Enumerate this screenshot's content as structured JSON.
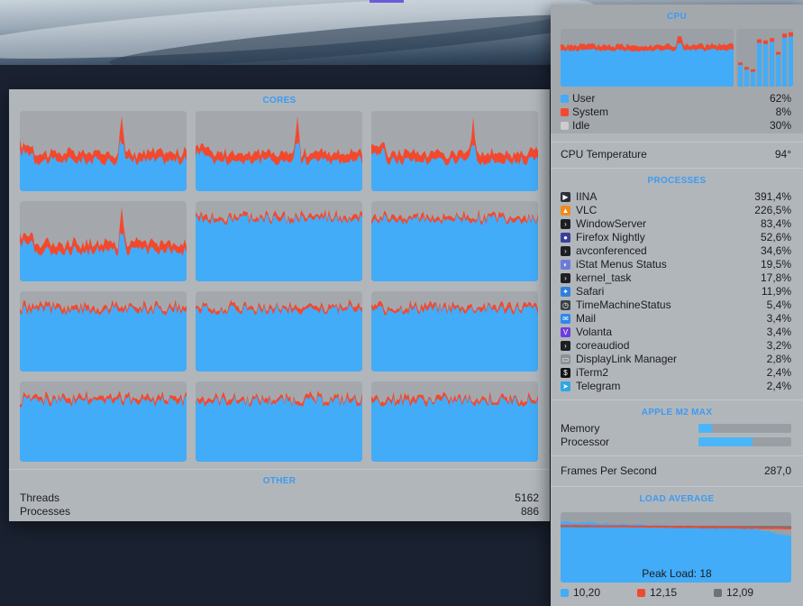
{
  "colors": {
    "user": "#42acf8",
    "system": "#f2492e",
    "idle": "#cbcccd",
    "load_1": "#42acf8",
    "load_5": "#f2492e",
    "load_15": "#6e7276",
    "accent": "#3d9bf0"
  },
  "cores_panel": {
    "title": "CORES",
    "core_count": 12,
    "other_title": "OTHER",
    "threads_label": "Threads",
    "threads_value": "5162",
    "processes_label": "Processes",
    "processes_value": "886"
  },
  "cpu_panel": {
    "title": "CPU",
    "core_bar_levels": [
      0.42,
      0.34,
      0.3,
      0.82,
      0.8,
      0.84,
      0.6,
      0.92,
      0.94
    ],
    "legend": [
      {
        "label": "User",
        "value": "62%",
        "color_key": "user"
      },
      {
        "label": "System",
        "value": "8%",
        "color_key": "system"
      },
      {
        "label": "Idle",
        "value": "30%",
        "color_key": "idle"
      }
    ],
    "temperature_label": "CPU Temperature",
    "temperature_value": "94°",
    "processes_title": "PROCESSES",
    "processes": [
      {
        "name": "IINA",
        "value": "391,4%",
        "icon": "iina-icon",
        "color": "#2a2f3a",
        "glyph": "▶"
      },
      {
        "name": "VLC",
        "value": "226,5%",
        "icon": "vlc-cone-icon",
        "color": "#f08a1c",
        "glyph": "▲"
      },
      {
        "name": "WindowServer",
        "value": "83,4%",
        "icon": "terminal-exec-icon",
        "color": "#1d1f22",
        "glyph": "›"
      },
      {
        "name": "Firefox Nightly",
        "value": "52,6%",
        "icon": "firefox-nightly-icon",
        "color": "#3b3f9a",
        "glyph": "●"
      },
      {
        "name": "avconferenced",
        "value": "34,6%",
        "icon": "terminal-exec-icon",
        "color": "#1d1f22",
        "glyph": "›"
      },
      {
        "name": "iStat Menus Status",
        "value": "19,5%",
        "icon": "istat-icon",
        "color": "#6b7bd8",
        "glyph": "◐"
      },
      {
        "name": "kernel_task",
        "value": "17,8%",
        "icon": "terminal-exec-icon",
        "color": "#1d1f22",
        "glyph": "›"
      },
      {
        "name": "Safari",
        "value": "11,9%",
        "icon": "safari-compass-icon",
        "color": "#2f7fe0",
        "glyph": "✦"
      },
      {
        "name": "TimeMachineStatus",
        "value": "5,4%",
        "icon": "time-machine-icon",
        "color": "#3b4048",
        "glyph": "◷"
      },
      {
        "name": "Mail",
        "value": "3,4%",
        "icon": "mail-envelope-icon",
        "color": "#2e86ef",
        "glyph": "✉"
      },
      {
        "name": "Volanta",
        "value": "3,4%",
        "icon": "volanta-icon",
        "color": "#6f3ce0",
        "glyph": "V"
      },
      {
        "name": "coreaudiod",
        "value": "3,2%",
        "icon": "terminal-exec-icon",
        "color": "#1d1f22",
        "glyph": "›"
      },
      {
        "name": "DisplayLink Manager",
        "value": "2,8%",
        "icon": "displaylink-icon",
        "color": "#8d9196",
        "glyph": "▭"
      },
      {
        "name": "iTerm2",
        "value": "2,4%",
        "icon": "iterm-icon",
        "color": "#121416",
        "glyph": "$"
      },
      {
        "name": "Telegram",
        "value": "2,4%",
        "icon": "telegram-icon",
        "color": "#2ea6e8",
        "glyph": "➤"
      }
    ],
    "gpu_title": "APPLE M2 MAX",
    "memory_label": "Memory",
    "memory_level": 0.15,
    "processor_label": "Processor",
    "processor_level": 0.58,
    "fps_label": "Frames Per Second",
    "fps_value": "287,0",
    "load_title": "LOAD AVERAGE",
    "peak_load": "Peak Load: 18",
    "load_values": [
      {
        "value": "10,20",
        "color_key": "load_1"
      },
      {
        "value": "12,15",
        "color_key": "load_5"
      },
      {
        "value": "12,09",
        "color_key": "load_15"
      }
    ]
  }
}
